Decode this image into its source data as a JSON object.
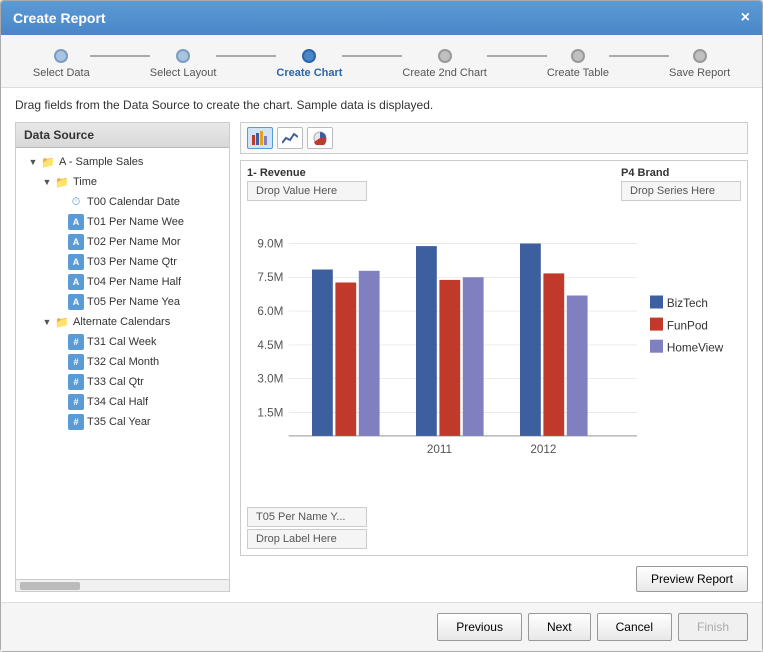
{
  "dialog": {
    "title": "Create Report",
    "close_label": "×"
  },
  "wizard": {
    "steps": [
      {
        "id": "select-data",
        "label": "Select Data",
        "state": "completed"
      },
      {
        "id": "select-layout",
        "label": "Select Layout",
        "state": "completed"
      },
      {
        "id": "create-chart",
        "label": "Create Chart",
        "state": "active"
      },
      {
        "id": "create-2nd-chart",
        "label": "Create 2nd Chart",
        "state": "inactive"
      },
      {
        "id": "create-table",
        "label": "Create Table",
        "state": "inactive"
      },
      {
        "id": "save-report",
        "label": "Save Report",
        "state": "inactive"
      }
    ]
  },
  "instruction": "Drag fields from the Data Source to create the chart. Sample data is displayed.",
  "data_source": {
    "header": "Data Source",
    "tree": [
      {
        "id": "a-sample-sales",
        "label": "A - Sample Sales",
        "indent": 1,
        "type": "root-folder",
        "expanded": true
      },
      {
        "id": "time",
        "label": "Time",
        "indent": 2,
        "type": "folder",
        "expanded": true
      },
      {
        "id": "t00-calendar-date",
        "label": "T00 Calendar Date",
        "indent": 3,
        "type": "clock"
      },
      {
        "id": "t01-per-name-wee",
        "label": "T01 Per Name Wee",
        "indent": 3,
        "type": "a"
      },
      {
        "id": "t02-per-name-mor",
        "label": "T02 Per Name Mor",
        "indent": 3,
        "type": "a"
      },
      {
        "id": "t03-per-name-qtr",
        "label": "T03 Per Name Qtr",
        "indent": 3,
        "type": "a"
      },
      {
        "id": "t04-per-name-hal",
        "label": "T04 Per Name Half",
        "indent": 3,
        "type": "a"
      },
      {
        "id": "t05-per-name-yea",
        "label": "T05 Per Name Yea",
        "indent": 3,
        "type": "a"
      },
      {
        "id": "alternate-calendars",
        "label": "Alternate Calendars",
        "indent": 2,
        "type": "folder",
        "expanded": true
      },
      {
        "id": "t31-cal-week",
        "label": "T31 Cal Week",
        "indent": 3,
        "type": "hash"
      },
      {
        "id": "t32-cal-month",
        "label": "T32 Cal Month",
        "indent": 3,
        "type": "hash"
      },
      {
        "id": "t33-cal-qtr",
        "label": "T33 Cal Qtr",
        "indent": 3,
        "type": "hash"
      },
      {
        "id": "t34-cal-half",
        "label": "T34 Cal Half",
        "indent": 3,
        "type": "hash"
      },
      {
        "id": "t35-cal-year",
        "label": "T35 Cal Year",
        "indent": 3,
        "type": "hash"
      }
    ]
  },
  "chart": {
    "drop_value_label": "1- Revenue",
    "drop_value_hint": "Drop Value Here",
    "drop_series_label": "P4 Brand",
    "drop_series_hint": "Drop Series Here",
    "drop_label_current": "T05 Per Name Y...",
    "drop_label_hint": "Drop Label Here",
    "y_axis_labels": [
      "9.0M",
      "7.5M",
      "6.0M",
      "4.5M",
      "3.0M",
      "1.5M"
    ],
    "x_axis_labels": [
      "2011",
      "2012"
    ],
    "legend": [
      {
        "id": "biztech",
        "label": "BizTech",
        "color": "#3d5fa0"
      },
      {
        "id": "funpod",
        "label": "FunPod",
        "color": "#c0392b"
      },
      {
        "id": "homeview",
        "label": "HomeView",
        "color": "#8080c0"
      }
    ],
    "bars": {
      "group1_year": "2011",
      "group2_year": "2012",
      "group1": [
        {
          "series": "BizTech",
          "value": 7.8,
          "color": "#3d5fa0"
        },
        {
          "series": "FunPod",
          "value": 7.2,
          "color": "#c0392b"
        },
        {
          "series": "HomeView",
          "value": 7.7,
          "color": "#8080c0"
        }
      ],
      "group2": [
        {
          "series": "BizTech",
          "value": 8.9,
          "color": "#3d5fa0"
        },
        {
          "series": "FunPod",
          "value": 7.3,
          "color": "#c0392b"
        },
        {
          "series": "HomeView",
          "value": 7.4,
          "color": "#8080c0"
        }
      ],
      "group3": [
        {
          "series": "BizTech",
          "value": 9.0,
          "color": "#3d5fa0"
        },
        {
          "series": "FunPod",
          "value": 7.6,
          "color": "#c0392b"
        },
        {
          "series": "HomeView",
          "value": 6.6,
          "color": "#8080c0"
        }
      ]
    }
  },
  "buttons": {
    "preview_report": "Preview Report",
    "previous": "Previous",
    "next": "Next",
    "cancel": "Cancel",
    "finish": "Finish"
  }
}
